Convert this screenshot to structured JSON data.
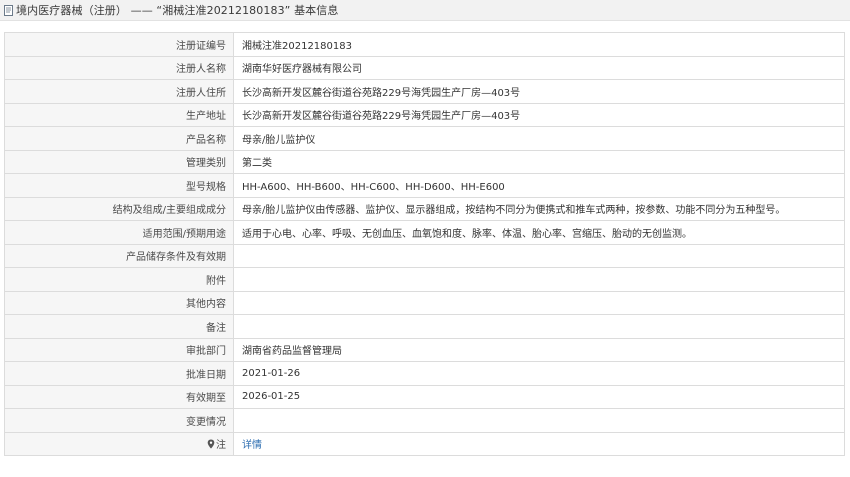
{
  "header": {
    "icon": "document-icon",
    "title": "境内医疗器械（注册） —— “湘械注准20212180183” 基本信息"
  },
  "rows": [
    {
      "label": "注册证编号",
      "value": "湘械注准20212180183"
    },
    {
      "label": "注册人名称",
      "value": "湖南华好医疗器械有限公司"
    },
    {
      "label": "注册人住所",
      "value": "长沙高新开发区麓谷街道谷苑路229号海凭园生产厂房—403号"
    },
    {
      "label": "生产地址",
      "value": "长沙高新开发区麓谷街道谷苑路229号海凭园生产厂房—403号"
    },
    {
      "label": "产品名称",
      "value": "母亲/胎儿监护仪"
    },
    {
      "label": "管理类别",
      "value": "第二类"
    },
    {
      "label": "型号规格",
      "value": "HH-A600、HH-B600、HH-C600、HH-D600、HH-E600"
    },
    {
      "label": "结构及组成/主要组成成分",
      "value": "母亲/胎儿监护仪由传感器、监护仪、显示器组成，按结构不同分为便携式和推车式两种，按参数、功能不同分为五种型号。"
    },
    {
      "label": "适用范围/预期用途",
      "value": "适用于心电、心率、呼吸、无创血压、血氧饱和度、脉率、体温、胎心率、宫缩压、胎动的无创监测。"
    },
    {
      "label": "产品储存条件及有效期",
      "value": ""
    },
    {
      "label": "附件",
      "value": ""
    },
    {
      "label": "其他内容",
      "value": ""
    },
    {
      "label": "备注",
      "value": ""
    },
    {
      "label": "审批部门",
      "value": "湖南省药品监督管理局"
    },
    {
      "label": "批准日期",
      "value": "2021-01-26"
    },
    {
      "label": "有效期至",
      "value": "2026-01-25"
    },
    {
      "label": "变更情况",
      "value": ""
    }
  ],
  "note_row": {
    "icon": "pin-icon",
    "label": "注",
    "link": "详情"
  }
}
